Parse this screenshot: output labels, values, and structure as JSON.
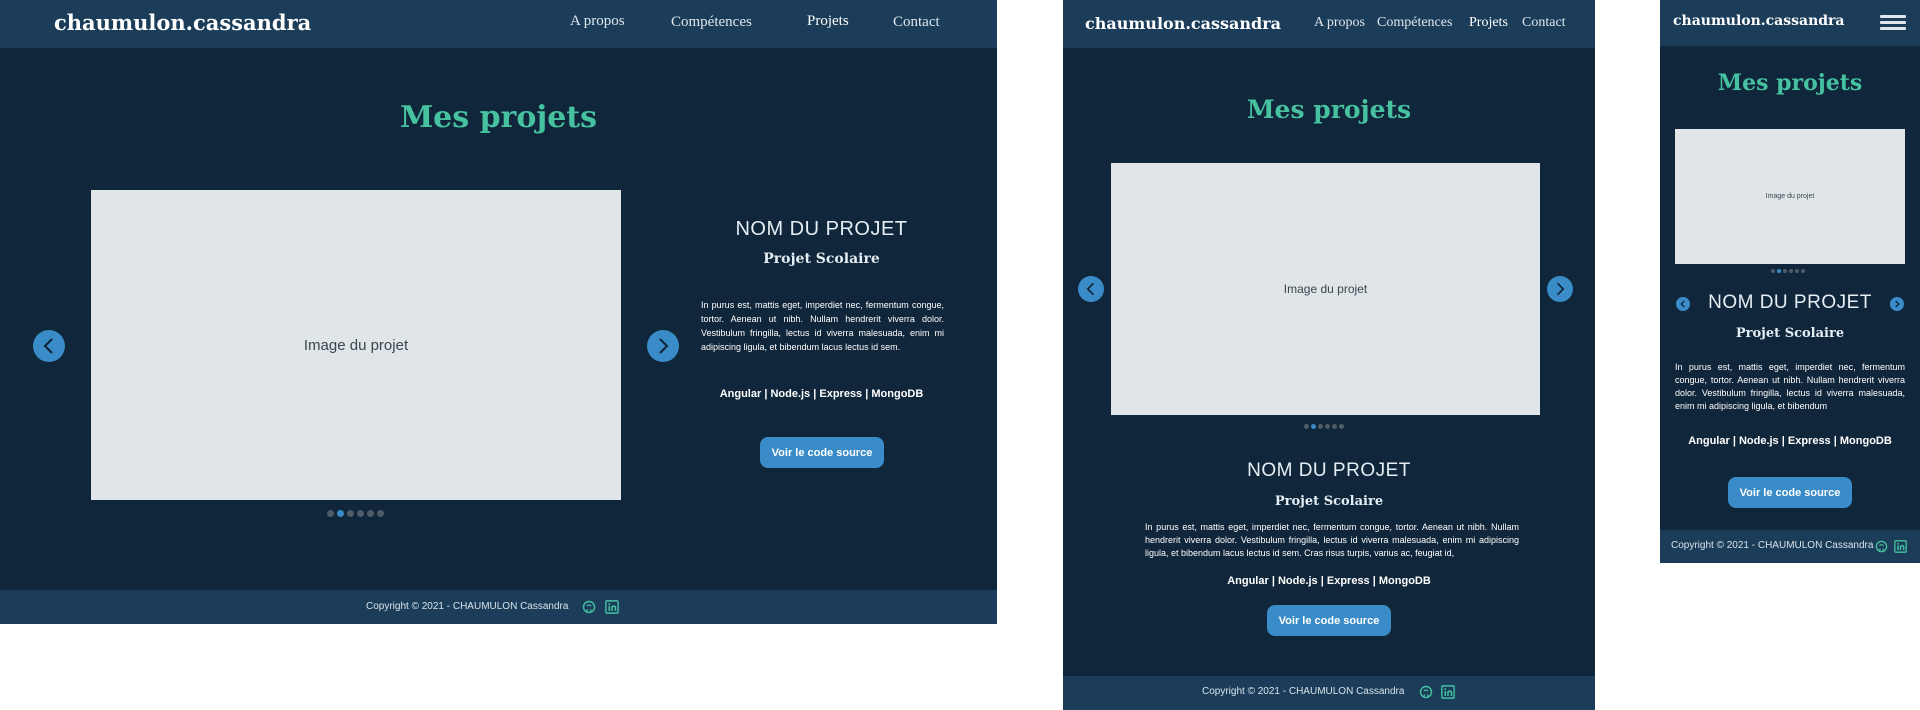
{
  "brand": "chaumulon.cassandra",
  "nav": {
    "about": "A propos",
    "skills": "Compétences",
    "projects": "Projets",
    "contact": "Contact"
  },
  "section_title": "Mes projets",
  "project": {
    "image_label": "Image du projet",
    "name": "NOM DU PROJET",
    "type": "Projet Scolaire",
    "description_desktop": "In purus est, mattis eget, imperdiet nec, fermentum congue, tortor. Aenean ut nibh. Nullam hendrerit viverra dolor. Vestibulum fringilla, lectus id viverra malesuada, enim mi adipiscing ligula, et bibendum lacus lectus id sem.",
    "description_tablet": "In purus est, mattis eget, imperdiet nec, fermentum congue, tortor. Aenean ut nibh. Nullam hendrerit viverra dolor. Vestibulum fringilla, lectus id viverra malesuada, enim mi adipiscing ligula, et bibendum lacus lectus id sem. Cras risus turpis, varius ac, feugiat id,",
    "description_mobile": "In purus est, mattis eget, imperdiet nec, fermentum congue, tortor. Aenean ut nibh. Nullam hendrerit viverra dolor. Vestibulum fringilla, lectus id viverra malesuada, enim mi adipiscing ligula, et bibendum",
    "stack": "Angular | Node.js | Express | MongoDB",
    "button": "Voir le code source"
  },
  "carousel": {
    "slide_count": 6,
    "active_index": 1
  },
  "footer": {
    "copyright": "Copyright © 2021 - CHAUMULON Cassandra"
  },
  "icons": {
    "prev": "chevron-left-icon",
    "next": "chevron-right-icon",
    "github": "github-icon",
    "linkedin": "linkedin-icon",
    "menu": "hamburger-menu-icon"
  },
  "colors": {
    "background": "#10263a",
    "header": "#1b3d59",
    "accent_green": "#46c2a0",
    "accent_blue": "#3a8cc8",
    "placeholder": "#e0e5e8"
  }
}
